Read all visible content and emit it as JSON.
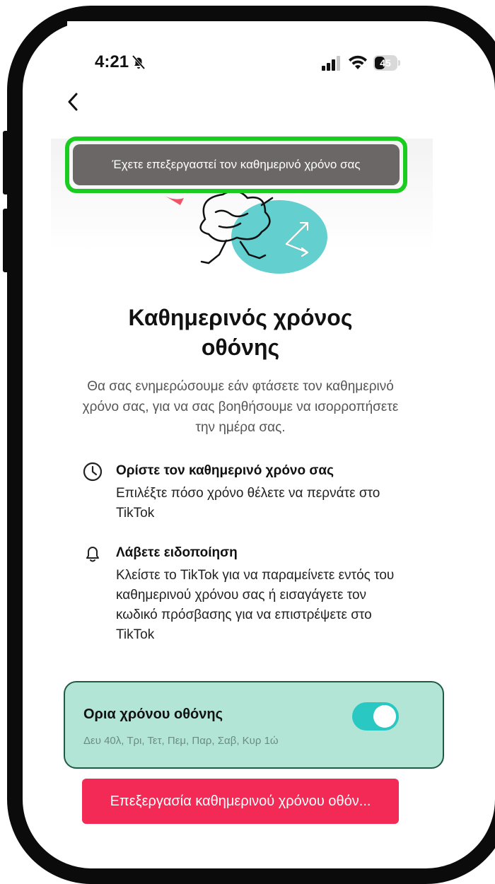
{
  "status_bar": {
    "time": "4:21",
    "battery": "45"
  },
  "toast": {
    "message": "Έχετε επεξεργαστεί τον καθημερινό χρόνο σας"
  },
  "header": {
    "title": "Καθημερινός χρόνος οθόνης",
    "description": "Θα σας ενημερώσουμε εάν φτάσετε τον καθημερινό χρόνο σας, για να σας βοηθήσουμε να ισορροπήσετε την ημέρα σας."
  },
  "features": [
    {
      "icon": "clock-icon",
      "title": "Ορίστε τον καθημερινό χρόνο σας",
      "body": "Επιλέξτε πόσο χρόνο θέλετε να περνάτε στο TikTok"
    },
    {
      "icon": "bell-icon",
      "title": "Λάβετε ειδοποίηση",
      "body": "Κλείστε το TikTok για να παραμείνετε εντός του καθημερινού χρόνου σας ή εισαγάγετε τον κωδικό πρόσβασης για να επιστρέψετε στο TikTok"
    }
  ],
  "limits_card": {
    "title": "Ορια χρόνου οθόνης",
    "schedule": "Δευ 40λ, Τρι, Τετ, Πεμ, Παρ, Σαβ, Κυρ 1ώ",
    "enabled": true
  },
  "edit_button": {
    "label": "Επεξεργασία καθημερινού χρόνου οθόν..."
  },
  "colors": {
    "toast_bg": "#6b6766",
    "highlight": "#19cc1f",
    "card_bg": "#b3e5d6",
    "toggle_on": "#2ac8c2",
    "primary": "#f22a55"
  }
}
